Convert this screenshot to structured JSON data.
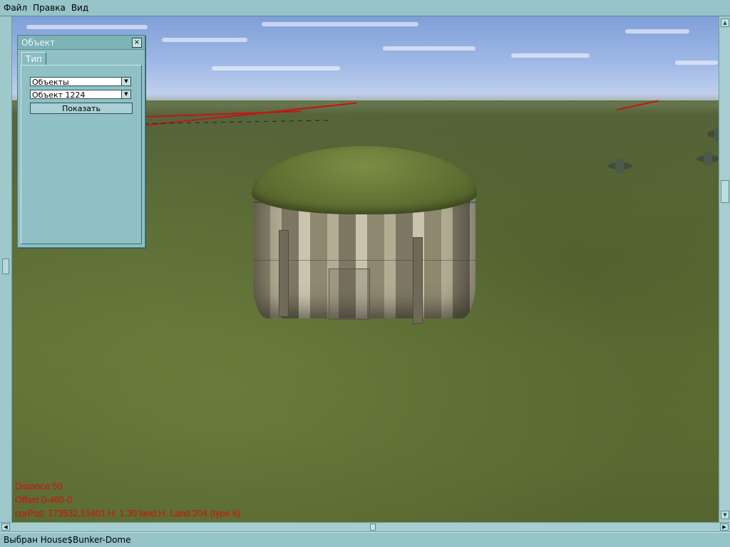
{
  "menu": {
    "items": [
      {
        "label": "Файл"
      },
      {
        "label": "Правка"
      },
      {
        "label": "Вид"
      }
    ]
  },
  "object_window": {
    "title": "Объект",
    "close_glyph": "×",
    "tab_label": "Тип",
    "category_select": {
      "value": "Объекты"
    },
    "object_select": {
      "value": "Объект 1224"
    },
    "show_button": "Показать"
  },
  "debug_overlay": {
    "lines": [
      "Distance 50",
      "Offset 0-460-0",
      "curPos: 173532.15401 H: 1.30 land H: Land 204 (type 6)"
    ]
  },
  "status_bar": {
    "text": "Выбран House$Bunker-Dome"
  },
  "colors": {
    "chrome": "#96c4c8",
    "debug_text": "#d01010",
    "red_lines": "#c0161a"
  },
  "icons": {
    "close": "close-icon",
    "dropdown": "chevron-down-icon"
  }
}
